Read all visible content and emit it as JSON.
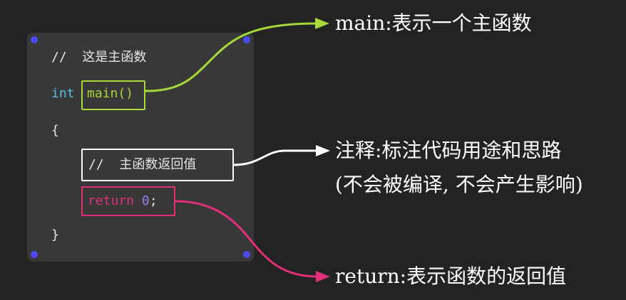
{
  "code": {
    "comment_line": "//  这是主函数",
    "int_keyword": "int",
    "main_call": "main()",
    "open_brace": "{",
    "inner_comment": "//  主函数返回值",
    "return_keyword": "return",
    "return_value": "0",
    "semicolon": ";",
    "close_brace": "}"
  },
  "annotations": {
    "main": "main:表示一个主函数",
    "comment_line1": "注释:标注代码用途和思路",
    "comment_line2": "(不会被编译, 不会产生影响)",
    "return": "return:表示函数的返回值"
  },
  "colors": {
    "background": "#232323",
    "panel": "#383838",
    "corner_dot": "#4a4cf0",
    "int_keyword": "#4fc3dc",
    "main_highlight": "#a6d83a",
    "comment_highlight": "#ffffff",
    "return_highlight": "#e0307a",
    "number": "#9a7cf0"
  }
}
